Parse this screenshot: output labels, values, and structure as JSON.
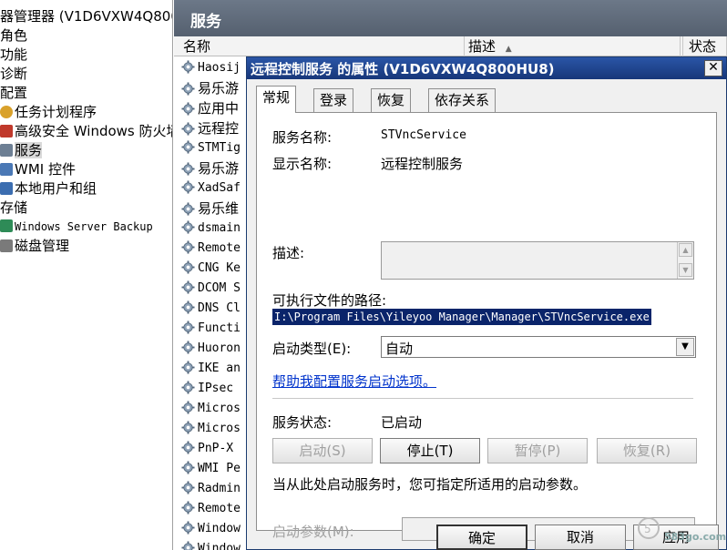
{
  "tree": {
    "items": [
      {
        "label": "器管理器 (V1D6VXW4Q800HU",
        "icon": "",
        "mono": false,
        "indent": 0
      },
      {
        "label": "角色",
        "icon": "",
        "mono": false,
        "indent": 0
      },
      {
        "label": "功能",
        "icon": "",
        "mono": false,
        "indent": 0
      },
      {
        "label": "诊断",
        "icon": "",
        "mono": false,
        "indent": 0
      },
      {
        "label": "配置",
        "icon": "",
        "mono": false,
        "indent": 0
      },
      {
        "label": "任务计划程序",
        "icon": "clock-icon",
        "mono": false,
        "indent": 2
      },
      {
        "label": "高级安全 Windows 防火墙",
        "icon": "firewall-icon",
        "mono": false,
        "indent": 2
      },
      {
        "label": "服务",
        "icon": "services-icon",
        "mono": false,
        "indent": 2,
        "selected": true
      },
      {
        "label": "WMI 控件",
        "icon": "wmi-icon",
        "mono": false,
        "indent": 2
      },
      {
        "label": "本地用户和组",
        "icon": "users-icon",
        "mono": false,
        "indent": 2
      },
      {
        "label": "存储",
        "icon": "",
        "mono": false,
        "indent": 0
      },
      {
        "label": "Windows Server Backup",
        "icon": "backup-icon",
        "mono": true,
        "indent": 2
      },
      {
        "label": "磁盘管理",
        "icon": "disk-icon",
        "mono": false,
        "indent": 2
      }
    ]
  },
  "services_pane": {
    "header": "服务",
    "columns": {
      "name": "名称",
      "desc": "描述",
      "status": "状态"
    },
    "rows": [
      "Haosij",
      "易乐游",
      "应用中",
      "远程控",
      "STMTig",
      "易乐游",
      "XadSaf",
      "易乐维",
      "dsmain",
      "Remote",
      "CNG Ke",
      "DCOM S",
      "DNS Cl",
      "Functi",
      "Huoron",
      "IKE an",
      "IPsec",
      "Micros",
      "Micros",
      "PnP-X",
      "WMI Pe",
      "Radmin",
      "Remote",
      "Window",
      "Window"
    ]
  },
  "dialog": {
    "title": "远程控制服务 的属性 (V1D6VXW4Q800HU8)",
    "close": "✕",
    "tabs": [
      "常规",
      "登录",
      "恢复",
      "依存关系"
    ],
    "active_tab": 0,
    "service_name_label": "服务名称:",
    "service_name": "STVncService",
    "display_name_label": "显示名称:",
    "display_name": "远程控制服务",
    "description_label": "描述:",
    "description": "",
    "path_label": "可执行文件的路径:",
    "path": "I:\\Program Files\\Yileyoo Manager\\Manager\\STVncService.exe",
    "startup_type_label": "启动类型(E):",
    "startup_type": "自动",
    "help_link": "帮助我配置服务启动选项。",
    "status_label": "服务状态:",
    "status": "已启动",
    "buttons": {
      "start": "启动(S)",
      "stop": "停止(T)",
      "pause": "暂停(P)",
      "resume": "恢复(R)"
    },
    "hint": "当从此处启动服务时，您可指定所适用的启动参数。",
    "params_label": "启动参数(M):",
    "params": "",
    "footer": {
      "ok": "确定",
      "cancel": "取消",
      "apply": "应用"
    }
  },
  "watermark": "583go.com"
}
